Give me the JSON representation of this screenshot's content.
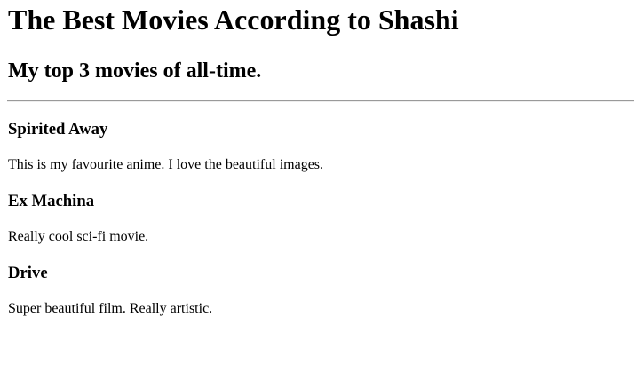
{
  "page": {
    "title": "The Best Movies According to Shashi",
    "subtitle": "My top 3 movies of all-time."
  },
  "movies": [
    {
      "title": "Spirited Away",
      "description": "This is my favourite anime. I love the beautiful images."
    },
    {
      "title": "Ex Machina",
      "description": "Really cool sci-fi movie."
    },
    {
      "title": "Drive",
      "description": "Super beautiful film. Really artistic."
    }
  ]
}
